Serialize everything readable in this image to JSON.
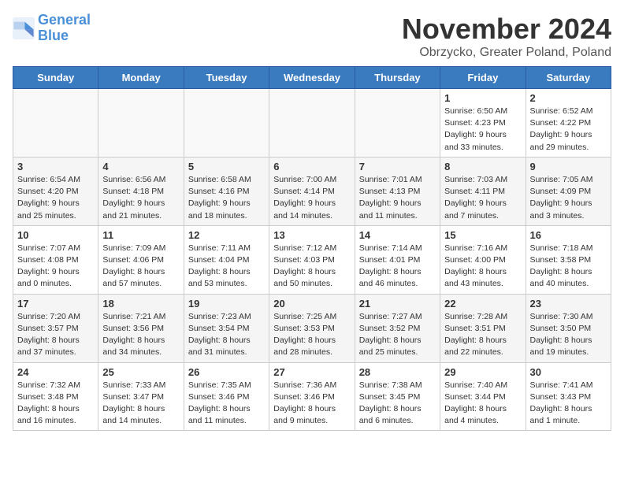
{
  "logo": {
    "line1": "General",
    "line2": "Blue"
  },
  "title": "November 2024",
  "location": "Obrzycko, Greater Poland, Poland",
  "days_of_week": [
    "Sunday",
    "Monday",
    "Tuesday",
    "Wednesday",
    "Thursday",
    "Friday",
    "Saturday"
  ],
  "weeks": [
    [
      {
        "day": "",
        "info": "",
        "empty": true
      },
      {
        "day": "",
        "info": "",
        "empty": true
      },
      {
        "day": "",
        "info": "",
        "empty": true
      },
      {
        "day": "",
        "info": "",
        "empty": true
      },
      {
        "day": "",
        "info": "",
        "empty": true
      },
      {
        "day": "1",
        "info": "Sunrise: 6:50 AM\nSunset: 4:23 PM\nDaylight: 9 hours\nand 33 minutes."
      },
      {
        "day": "2",
        "info": "Sunrise: 6:52 AM\nSunset: 4:22 PM\nDaylight: 9 hours\nand 29 minutes."
      }
    ],
    [
      {
        "day": "3",
        "info": "Sunrise: 6:54 AM\nSunset: 4:20 PM\nDaylight: 9 hours\nand 25 minutes."
      },
      {
        "day": "4",
        "info": "Sunrise: 6:56 AM\nSunset: 4:18 PM\nDaylight: 9 hours\nand 21 minutes."
      },
      {
        "day": "5",
        "info": "Sunrise: 6:58 AM\nSunset: 4:16 PM\nDaylight: 9 hours\nand 18 minutes."
      },
      {
        "day": "6",
        "info": "Sunrise: 7:00 AM\nSunset: 4:14 PM\nDaylight: 9 hours\nand 14 minutes."
      },
      {
        "day": "7",
        "info": "Sunrise: 7:01 AM\nSunset: 4:13 PM\nDaylight: 9 hours\nand 11 minutes."
      },
      {
        "day": "8",
        "info": "Sunrise: 7:03 AM\nSunset: 4:11 PM\nDaylight: 9 hours\nand 7 minutes."
      },
      {
        "day": "9",
        "info": "Sunrise: 7:05 AM\nSunset: 4:09 PM\nDaylight: 9 hours\nand 3 minutes."
      }
    ],
    [
      {
        "day": "10",
        "info": "Sunrise: 7:07 AM\nSunset: 4:08 PM\nDaylight: 9 hours\nand 0 minutes."
      },
      {
        "day": "11",
        "info": "Sunrise: 7:09 AM\nSunset: 4:06 PM\nDaylight: 8 hours\nand 57 minutes."
      },
      {
        "day": "12",
        "info": "Sunrise: 7:11 AM\nSunset: 4:04 PM\nDaylight: 8 hours\nand 53 minutes."
      },
      {
        "day": "13",
        "info": "Sunrise: 7:12 AM\nSunset: 4:03 PM\nDaylight: 8 hours\nand 50 minutes."
      },
      {
        "day": "14",
        "info": "Sunrise: 7:14 AM\nSunset: 4:01 PM\nDaylight: 8 hours\nand 46 minutes."
      },
      {
        "day": "15",
        "info": "Sunrise: 7:16 AM\nSunset: 4:00 PM\nDaylight: 8 hours\nand 43 minutes."
      },
      {
        "day": "16",
        "info": "Sunrise: 7:18 AM\nSunset: 3:58 PM\nDaylight: 8 hours\nand 40 minutes."
      }
    ],
    [
      {
        "day": "17",
        "info": "Sunrise: 7:20 AM\nSunset: 3:57 PM\nDaylight: 8 hours\nand 37 minutes."
      },
      {
        "day": "18",
        "info": "Sunrise: 7:21 AM\nSunset: 3:56 PM\nDaylight: 8 hours\nand 34 minutes."
      },
      {
        "day": "19",
        "info": "Sunrise: 7:23 AM\nSunset: 3:54 PM\nDaylight: 8 hours\nand 31 minutes."
      },
      {
        "day": "20",
        "info": "Sunrise: 7:25 AM\nSunset: 3:53 PM\nDaylight: 8 hours\nand 28 minutes."
      },
      {
        "day": "21",
        "info": "Sunrise: 7:27 AM\nSunset: 3:52 PM\nDaylight: 8 hours\nand 25 minutes."
      },
      {
        "day": "22",
        "info": "Sunrise: 7:28 AM\nSunset: 3:51 PM\nDaylight: 8 hours\nand 22 minutes."
      },
      {
        "day": "23",
        "info": "Sunrise: 7:30 AM\nSunset: 3:50 PM\nDaylight: 8 hours\nand 19 minutes."
      }
    ],
    [
      {
        "day": "24",
        "info": "Sunrise: 7:32 AM\nSunset: 3:48 PM\nDaylight: 8 hours\nand 16 minutes."
      },
      {
        "day": "25",
        "info": "Sunrise: 7:33 AM\nSunset: 3:47 PM\nDaylight: 8 hours\nand 14 minutes."
      },
      {
        "day": "26",
        "info": "Sunrise: 7:35 AM\nSunset: 3:46 PM\nDaylight: 8 hours\nand 11 minutes."
      },
      {
        "day": "27",
        "info": "Sunrise: 7:36 AM\nSunset: 3:46 PM\nDaylight: 8 hours\nand 9 minutes."
      },
      {
        "day": "28",
        "info": "Sunrise: 7:38 AM\nSunset: 3:45 PM\nDaylight: 8 hours\nand 6 minutes."
      },
      {
        "day": "29",
        "info": "Sunrise: 7:40 AM\nSunset: 3:44 PM\nDaylight: 8 hours\nand 4 minutes."
      },
      {
        "day": "30",
        "info": "Sunrise: 7:41 AM\nSunset: 3:43 PM\nDaylight: 8 hours\nand 1 minute."
      }
    ]
  ]
}
